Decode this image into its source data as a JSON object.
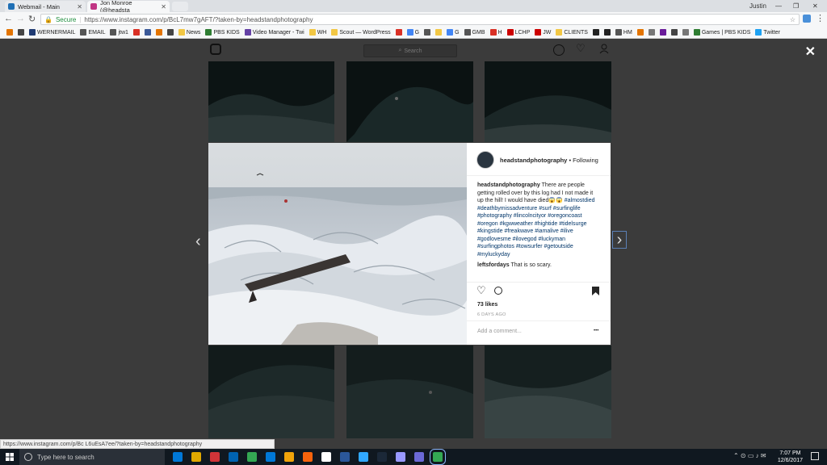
{
  "window": {
    "user_label": "Justin",
    "tabs": [
      {
        "label": "Webmail - Main",
        "icon": "mail-favicon",
        "color": "#1f6fb5"
      },
      {
        "label": "Jon Monroe (@headsta",
        "icon": "instagram-favicon",
        "color": "#c13584"
      }
    ]
  },
  "omnibox": {
    "secure_label": "Secure",
    "url": "https://www.instagram.com/p/BcL7mw7gAFT/?taken-by=headstandphotography"
  },
  "bookmarks": [
    {
      "label": "",
      "color": "#e37400"
    },
    {
      "label": "",
      "color": "#444"
    },
    {
      "label": "WERNERMAIL",
      "color": "#1f3b73"
    },
    {
      "label": "EMAIL",
      "color": "#555"
    },
    {
      "label": "jtw1",
      "color": "#555"
    },
    {
      "label": "",
      "color": "#d93025"
    },
    {
      "label": "",
      "color": "#3b5998"
    },
    {
      "label": "",
      "color": "#e37400"
    },
    {
      "label": "",
      "color": "#444"
    },
    {
      "label": "News",
      "color": "#f2c744"
    },
    {
      "label": "PBS KIDS",
      "color": "#2e7d32"
    },
    {
      "label": "Video Manager - Twi",
      "color": "#6441a5"
    },
    {
      "label": "WH",
      "color": "#f2c744"
    },
    {
      "label": "Scout — WordPress",
      "color": "#f2c744"
    },
    {
      "label": "",
      "color": "#d93025"
    },
    {
      "label": "G",
      "color": "#4285f4"
    },
    {
      "label": "",
      "color": "#555"
    },
    {
      "label": "",
      "color": "#f2c744"
    },
    {
      "label": "G",
      "color": "#4285f4"
    },
    {
      "label": "GMB",
      "color": "#555"
    },
    {
      "label": "H",
      "color": "#d93025"
    },
    {
      "label": "LCHP",
      "color": "#cc0000"
    },
    {
      "label": "JW",
      "color": "#cc0000"
    },
    {
      "label": "CLIENTS",
      "color": "#f2c744"
    },
    {
      "label": "",
      "color": "#222"
    },
    {
      "label": "",
      "color": "#222"
    },
    {
      "label": "HM",
      "color": "#555"
    },
    {
      "label": "",
      "color": "#e37400"
    },
    {
      "label": "",
      "color": "#777"
    },
    {
      "label": "",
      "color": "#6a1b9a"
    },
    {
      "label": "",
      "color": "#444"
    },
    {
      "label": "",
      "color": "#777"
    },
    {
      "label": "Games | PBS KIDS",
      "color": "#2e7d32"
    },
    {
      "label": "Twitter",
      "color": "#1da1f2"
    }
  ],
  "instagram": {
    "search_placeholder": "Search",
    "close_symbol": "✕",
    "prev_symbol": "‹",
    "next_symbol": "›"
  },
  "post": {
    "username": "headstandphotography",
    "follow_status": "• Following",
    "caption_user": "headstandphotography",
    "caption_text": "There are people getting rolled over by this log had I not made it up the hill! I would have died😱😱",
    "hashtags": [
      "#almostdied",
      "#deathbymissadventure",
      "#surf",
      "#surfinglife",
      "#photography",
      "#lincolncityor",
      "#oregoncoast",
      "#oregon",
      "#kgwweather",
      "#hightide",
      "#tidelsurge",
      "#kingstide",
      "#freakwave",
      "#iamalive",
      "#ilive",
      "#godlovesme",
      "#ilovegod",
      "#luckyman",
      "#surfingphotos",
      "#towsurfer",
      "#getoutside",
      "#myluckyday"
    ],
    "comment_user": "leftsfordays",
    "comment_text": "That is so scary.",
    "likes": "73 likes",
    "age": "6 DAYS AGO",
    "add_comment_placeholder": "Add a comment...",
    "more_symbol": "•••"
  },
  "status_bar_url": "https://www.instagram.com/p/Bc L6uEsA7ee/?taken-by=headstandphotography",
  "taskbar": {
    "search_placeholder": "Type here to search",
    "time": "7:07 PM",
    "date": "12/6/2017",
    "apps": [
      "#0078d7",
      "#e0a800",
      "#d13438",
      "#0063b1",
      "#34a853",
      "#0078d7",
      "#f0a30a",
      "#f7630c",
      "#fff",
      "#2b579a",
      "#31a8ff",
      "#1b2838",
      "#9999ff",
      "#6b69d6",
      "#34a853"
    ]
  }
}
